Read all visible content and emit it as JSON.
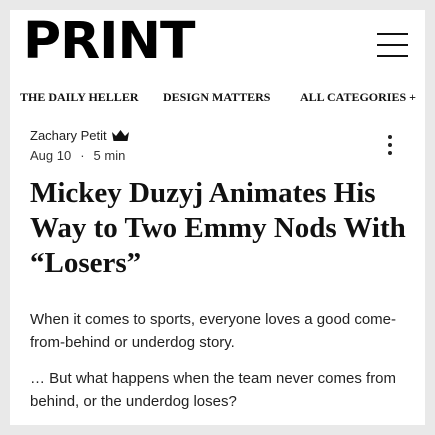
{
  "header": {
    "logo": "PRINT",
    "menu_icon": "hamburger-menu-icon"
  },
  "nav": {
    "items": [
      {
        "label": "THE DAILY HELLER"
      },
      {
        "label": "DESIGN MATTERS"
      },
      {
        "label": "ALL CATEGORIES +"
      }
    ]
  },
  "post": {
    "author": "Zachary Petit",
    "author_badge_icon": "crown-icon",
    "date": "Aug 10",
    "separator": "·",
    "read_time": "5 min",
    "more_icon": "more-vertical-icon",
    "title": "Mickey Duzyj Animates His Way to Two Emmy Nods With “Losers”",
    "paragraphs": [
      "When it comes to sports, everyone loves a good come-from-behind or underdog story.",
      "… But what happens when the team never comes from behind, or the underdog loses?"
    ]
  },
  "colors": {
    "background": "#e9e9e9",
    "card": "#ffffff",
    "text": "#111111"
  }
}
